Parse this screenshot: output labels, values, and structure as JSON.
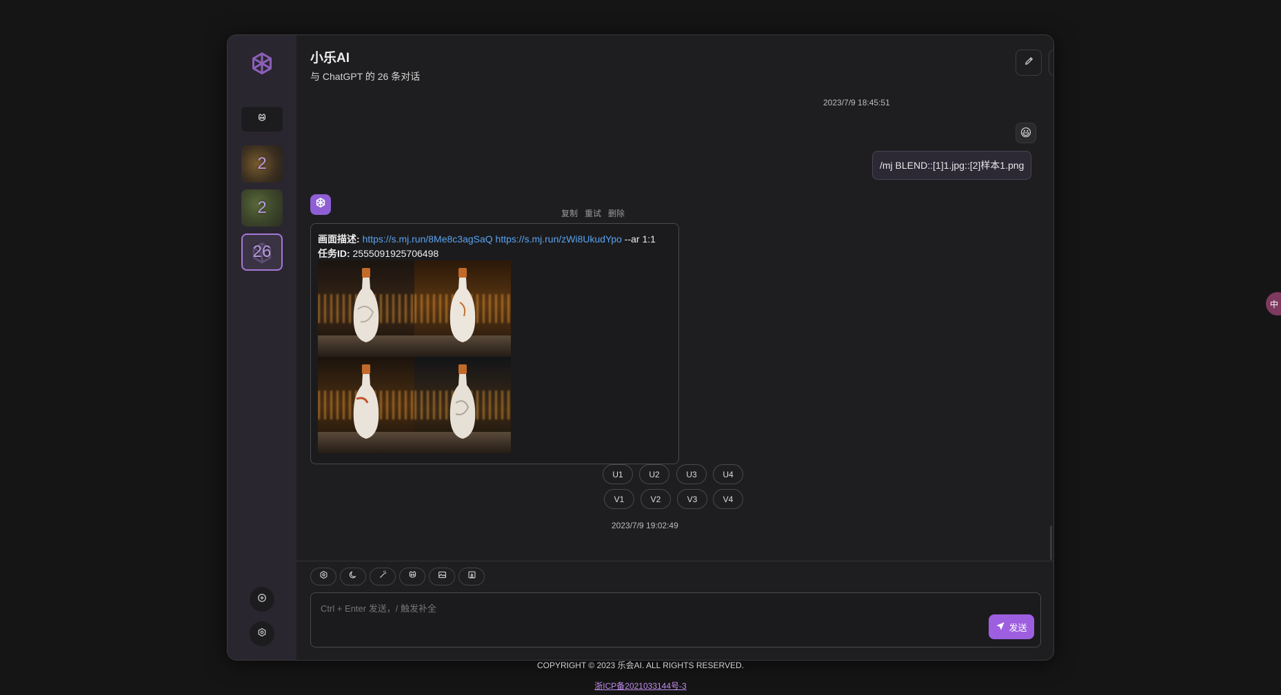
{
  "app": {
    "title": "小乐AI",
    "subtitle": "与 ChatGPT 的 26 条对话"
  },
  "sidebar": {
    "sessions": [
      {
        "count": "2"
      },
      {
        "count": "2"
      },
      {
        "count": "26",
        "active": true
      }
    ]
  },
  "header_buttons": [
    "edit-icon",
    "share-icon",
    "fullscreen-icon"
  ],
  "messages": {
    "user": {
      "time": "2023/7/9 18:45:51",
      "avatar": "😃",
      "text": "/mj BLEND::[1]1.jpg::[2]样本1.png"
    },
    "bot": {
      "actions": [
        "复制",
        "重试",
        "删除"
      ],
      "desc_label": "画面描述:",
      "link1": "https://s.mj.run/8Me8c3agSaQ",
      "link2": "https://s.mj.run/zWi8UkudYpo",
      "desc_suffix": " --ar 1:1",
      "task_label": "任务ID:",
      "task_id": " 2555091925706498",
      "upscale_buttons": [
        "U1",
        "U2",
        "U3",
        "U4"
      ],
      "variation_buttons": [
        "V1",
        "V2",
        "V3",
        "V4"
      ],
      "time": "2023/7/9 19:02:49"
    }
  },
  "composer": {
    "tools": [
      "settings-icon",
      "theme-icon",
      "prompt-icon",
      "mask-icon",
      "image-icon",
      "upload-icon"
    ],
    "placeholder": "Ctrl + Enter 发送，/ 触发补全",
    "send_label": "发送"
  },
  "footer": {
    "copyright": "COPYRIGHT © 2023 乐会AI. ALL RIGHTS RESERVED.",
    "icp": "浙ICP备2021033144号-3"
  },
  "float_label": "中",
  "colors": {
    "accent": "#9d5fe0",
    "link": "#5aa3f0",
    "background": "#151515",
    "panel": "#1e1e20",
    "sidebar": "#2a2630"
  }
}
